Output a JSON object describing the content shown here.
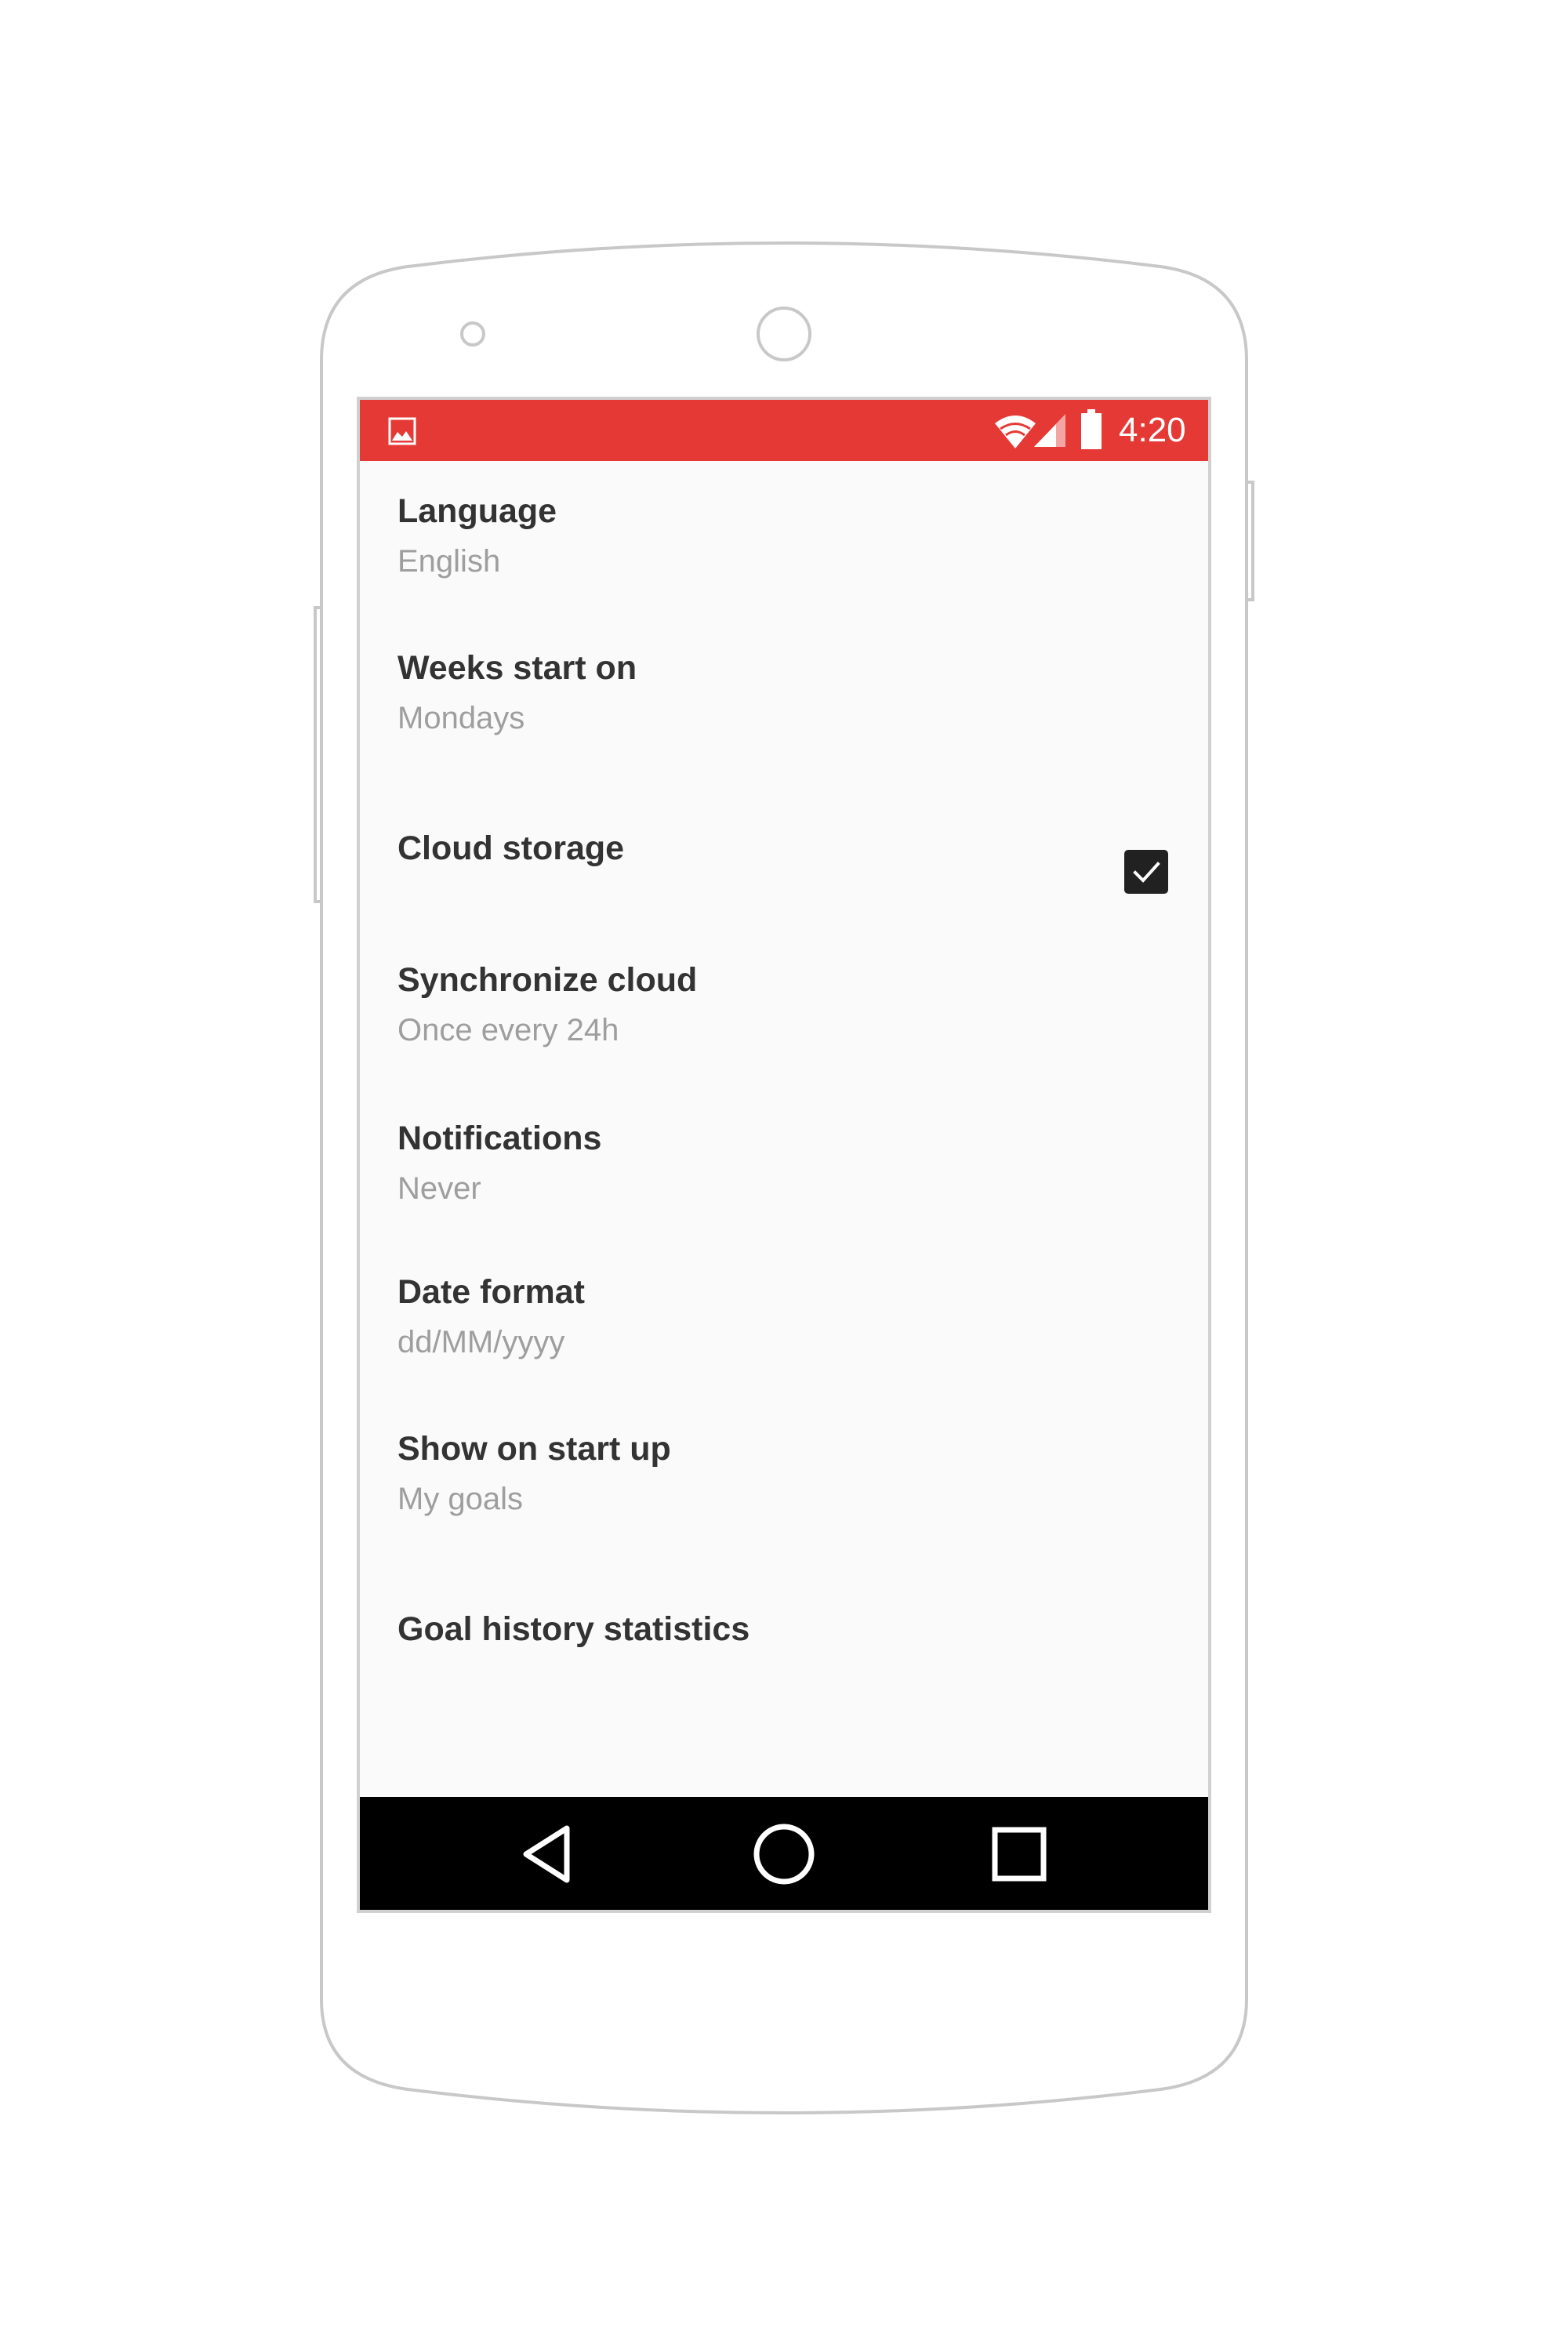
{
  "status_bar": {
    "time": "4:20",
    "color": "#e53935",
    "icons": [
      "gallery-icon",
      "wifi-icon",
      "signal-icon",
      "battery-icon"
    ]
  },
  "settings": [
    {
      "title": "Language",
      "value": "English"
    },
    {
      "title": "Weeks start on",
      "value": "Mondays"
    },
    {
      "title": "Cloud storage",
      "checked": true
    },
    {
      "title": "Synchronize cloud",
      "value": "Once every 24h"
    },
    {
      "title": "Notifications",
      "value": "Never"
    },
    {
      "title": "Date format",
      "value": "dd/MM/yyyy"
    },
    {
      "title": "Show on start up",
      "value": "My goals"
    },
    {
      "title": "Goal history statistics"
    }
  ],
  "nav_bar": {
    "icons": [
      "back-icon",
      "home-icon",
      "recents-icon"
    ]
  }
}
